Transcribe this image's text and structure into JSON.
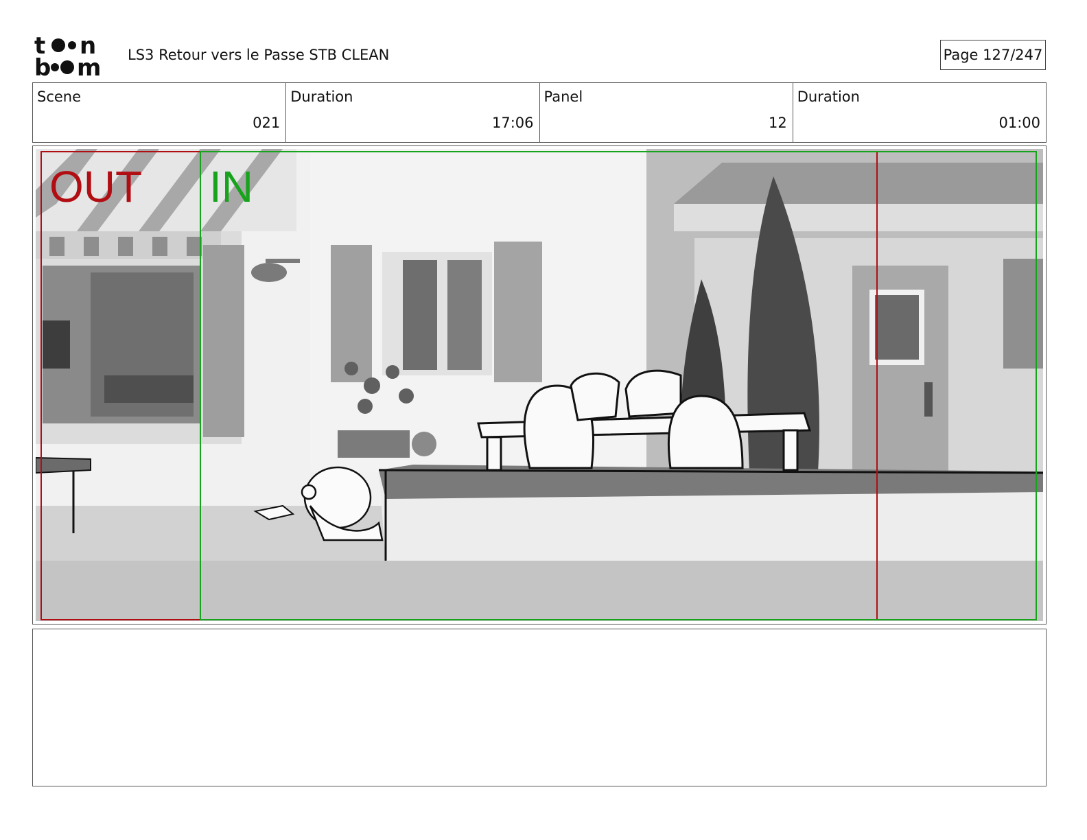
{
  "header": {
    "logo_text": "toon boom",
    "document_title": "LS3 Retour vers le Passe STB CLEAN",
    "page_label": "Page 127/247"
  },
  "info": {
    "scene_label": "Scene",
    "scene_value": "021",
    "scene_duration_label": "Duration",
    "scene_duration_value": "17:06",
    "panel_label": "Panel",
    "panel_value": "12",
    "panel_duration_label": "Duration",
    "panel_duration_value": "01:00"
  },
  "panel": {
    "out_tag": "OUT",
    "in_tag": "IN",
    "colors": {
      "out": "#b10e14",
      "in": "#17a31c"
    }
  },
  "notes": {}
}
